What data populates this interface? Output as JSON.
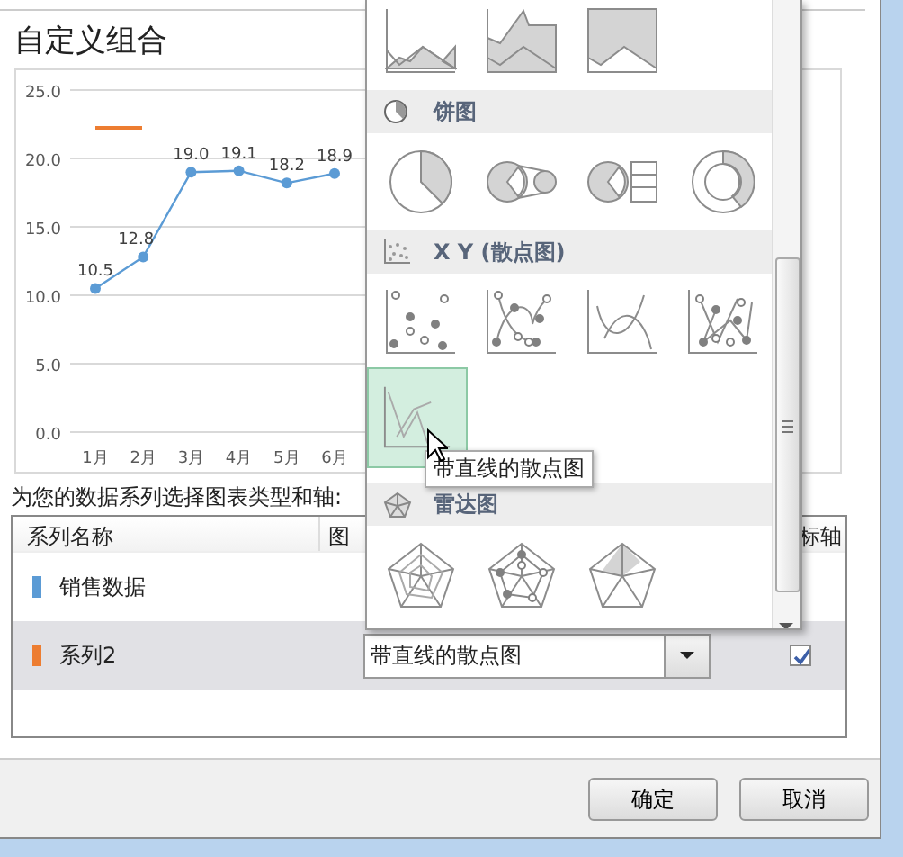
{
  "dialog": {
    "title": "自定义组合"
  },
  "chart": {
    "chart_data": {
      "type": "line",
      "categories": [
        "1月",
        "2月",
        "3月",
        "4月",
        "5月",
        "6月"
      ],
      "series": [
        {
          "color": "#5b9bd5",
          "values": [
            10.5,
            12.8,
            19.0,
            19.1,
            18.2,
            18.9
          ]
        }
      ],
      "ylim": [
        0,
        25
      ],
      "yticks": [
        {
          "value": 0,
          "label": "0.0"
        },
        {
          "value": 5,
          "label": "5.0"
        },
        {
          "value": 10,
          "label": "10.0"
        },
        {
          "value": 15,
          "label": "15.0"
        },
        {
          "value": 20,
          "label": "20.0"
        },
        {
          "value": 25,
          "label": "25.0"
        }
      ],
      "grid": true,
      "marker": "circle",
      "value_labels": [
        "10.5",
        "12.8",
        "19.0",
        "19.1",
        "18.2",
        "18.9"
      ]
    }
  },
  "chart_type_menu": {
    "sections": [
      {
        "kind": "area",
        "options": [
          {
            "selected": false
          },
          {
            "selected": false
          },
          {
            "selected": false
          }
        ]
      },
      {
        "kind": "pie",
        "title": "饼图",
        "options": [
          {
            "selected": false
          },
          {
            "selected": false
          },
          {
            "selected": false
          },
          {
            "selected": false
          }
        ]
      },
      {
        "kind": "scatter",
        "title": "X Y (散点图)",
        "options": [
          {
            "selected": false
          },
          {
            "selected": false
          },
          {
            "selected": false
          },
          {
            "selected": false
          },
          {
            "selected": true
          }
        ]
      },
      {
        "kind": "radar",
        "title": "雷达图",
        "options": [
          {
            "selected": false
          },
          {
            "selected": false
          },
          {
            "selected": false
          }
        ]
      }
    ]
  },
  "tooltip": "带直线的散点图",
  "series_prompt": "为您的数据系列选择图表类型和轴:",
  "series_table": {
    "columns": [
      "系列名称",
      "图",
      "标轴"
    ],
    "rows": [
      {
        "name": "销售数据",
        "color": "#5b9bd5",
        "selected": false
      },
      {
        "name": "系列2",
        "color": "#ed7d31",
        "selected": true,
        "chart_type": "带直线的散点图",
        "secondary_axis": true
      }
    ]
  },
  "buttons": [
    "确定",
    "取消"
  ]
}
